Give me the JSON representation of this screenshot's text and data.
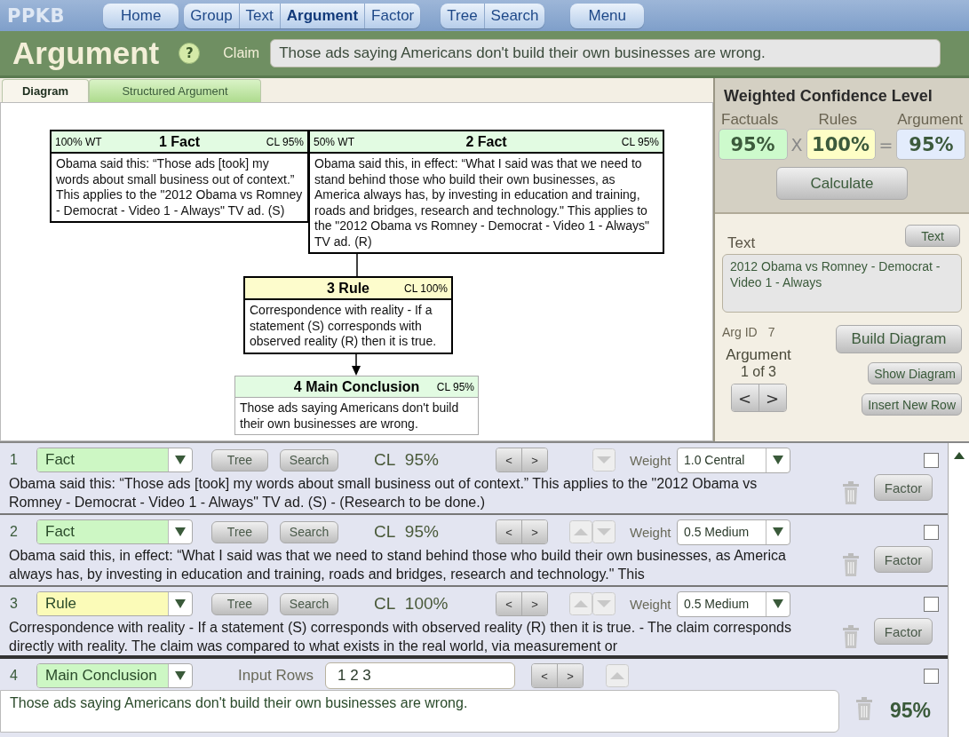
{
  "app": {
    "name": "PPKB"
  },
  "nav": [
    [
      {
        "label": "Home",
        "selected": false
      }
    ],
    [
      {
        "label": "Group",
        "selected": false
      },
      {
        "label": "Text",
        "selected": false
      },
      {
        "label": "Argument",
        "selected": true
      },
      {
        "label": "Factor",
        "selected": false
      }
    ],
    [
      {
        "label": "Tree",
        "selected": false
      },
      {
        "label": "Search",
        "selected": false
      }
    ],
    [
      {
        "label": "Menu",
        "selected": false
      }
    ]
  ],
  "header": {
    "title": "Argument",
    "help": "?",
    "claim_label": "Claim",
    "claim": "Those ads saying Americans don't build their own businesses are wrong."
  },
  "tabs": [
    {
      "label": "Diagram",
      "selected": true
    },
    {
      "label": "Structured Argument",
      "selected": false
    }
  ],
  "diagram": {
    "nodes": [
      {
        "kind": "fact",
        "weight": "100% WT",
        "title": "1 Fact",
        "cl": "CL 95%",
        "text": "Obama said this: “Those ads [took] my words about small business out of context.” This applies to the \"2012 Obama vs Romney - Democrat - Video 1 - Always\" TV ad. (S)"
      },
      {
        "kind": "fact",
        "weight": "50% WT",
        "title": "2 Fact",
        "cl": "CL 95%",
        "text": "Obama said this, in effect: “What I said was that we need to stand behind those who build their own businesses, as America always has, by investing in education and training, roads and bridges, research and technology.\" This applies to the \"2012 Obama vs Romney - Democrat - Video 1 - Always\" TV ad. (R)"
      },
      {
        "kind": "rule",
        "title": "3 Rule",
        "cl": "CL 100%",
        "text": "Correspondence with reality - If a statement (S) corresponds with observed reality (R) then it is true."
      },
      {
        "kind": "conclusion",
        "title": "4 Main Conclusion",
        "cl": "CL 95%",
        "text": "Those ads saying Americans don't build their own businesses are wrong."
      }
    ]
  },
  "confidence": {
    "title": "Weighted Confidence Level",
    "factuals_label": "Factuals",
    "factuals": "95%",
    "times": "X",
    "rules_label": "Rules",
    "rules": "100%",
    "equals": "=",
    "argument_label": "Argument",
    "argument": "95%",
    "calculate": "Calculate"
  },
  "text_panel": {
    "label": "Text",
    "button": "Text",
    "value": "2012 Obama vs Romney - Democrat - Video 1 - Always"
  },
  "arg_id": {
    "label": "Arg ID",
    "value": "7"
  },
  "argument_nav": {
    "label": "Argument",
    "position": "1 of 3",
    "prev": "<",
    "next": ">"
  },
  "side_buttons": {
    "build": "Build Diagram",
    "show": "Show Diagram",
    "insert": "Insert New Row"
  },
  "rows": [
    {
      "kind": "premise",
      "number": "1",
      "type": "Fact",
      "color": "#cdf7c4",
      "tree": "Tree",
      "search": "Search",
      "cl_label": "CL",
      "cl": "95%",
      "prev": "<",
      "next": ">",
      "move_up": false,
      "move_down": true,
      "weight_label": "Weight",
      "weight": "1.0 Central",
      "checked": false,
      "text": "Obama said this: “Those ads [took] my words about small business out of context.” This applies to the \"2012 Obama vs Romney - Democrat - Video 1 - Always\" TV ad. (S) - (Research to be done.)",
      "factor": "Factor"
    },
    {
      "kind": "premise",
      "number": "2",
      "type": "Fact",
      "color": "#cdf7c4",
      "tree": "Tree",
      "search": "Search",
      "cl_label": "CL",
      "cl": "95%",
      "prev": "<",
      "next": ">",
      "move_up": true,
      "move_down": true,
      "weight_label": "Weight",
      "weight": "0.5 Medium",
      "checked": false,
      "text": "Obama said this, in effect: “What I said was that we need to stand behind those who build their own businesses, as America always has, by investing in education and training, roads and bridges, research and technology.\" This",
      "factor": "Factor"
    },
    {
      "kind": "premise",
      "number": "3",
      "type": "Rule",
      "color": "#fbfbb8",
      "tree": "Tree",
      "search": "Search",
      "cl_label": "CL",
      "cl": "100%",
      "prev": "<",
      "next": ">",
      "move_up": true,
      "move_down": true,
      "weight_label": "Weight",
      "weight": "0.5 Medium",
      "checked": false,
      "text": "Correspondence with reality - If a statement (S) corresponds with observed reality (R) then it is true. - The claim corresponds directly with reality. The claim was compared to what exists in the real world, via measurement or",
      "factor": "Factor"
    },
    {
      "kind": "conclusion",
      "number": "4",
      "type": "Main Conclusion",
      "color": "#cdf7c4",
      "input_label": "Input Rows",
      "input": "1 2 3",
      "prev": "<",
      "next": ">",
      "move_up": true,
      "move_down": false,
      "checked": false,
      "text": "Those ads saying Americans don't build their own businesses are wrong.",
      "result": "95%"
    }
  ]
}
